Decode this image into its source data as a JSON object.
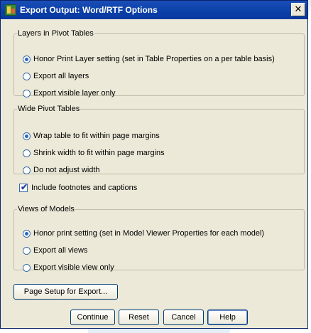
{
  "window": {
    "title": "Export Output: Word/RTF Options",
    "close_glyph": "✕"
  },
  "layers_group": {
    "legend": "Layers in Pivot Tables",
    "options": [
      {
        "label": "Honor Print Layer setting (set in Table Properties on a per table basis)",
        "selected": true
      },
      {
        "label": "Export all layers",
        "selected": false
      },
      {
        "label": "Export visible layer only",
        "selected": false
      }
    ]
  },
  "wide_group": {
    "legend": "Wide Pivot Tables",
    "options": [
      {
        "label": "Wrap table to fit within page margins",
        "selected": true
      },
      {
        "label": "Shrink width to fit within page margins",
        "selected": false
      },
      {
        "label": "Do not adjust width",
        "selected": false
      }
    ]
  },
  "footnotes": {
    "label": "Include footnotes and captions",
    "checked": true,
    "check_glyph": "✔"
  },
  "models_group": {
    "legend": "Views of Models",
    "options": [
      {
        "label": "Honor print setting (set in Model Viewer Properties for each model)",
        "selected": true
      },
      {
        "label": "Export all views",
        "selected": false
      },
      {
        "label": "Export visible view only",
        "selected": false
      }
    ]
  },
  "buttons": {
    "page_setup": "Page Setup for Export...",
    "continue": "Continue",
    "reset": "Reset",
    "cancel": "Cancel",
    "help": "Help"
  }
}
